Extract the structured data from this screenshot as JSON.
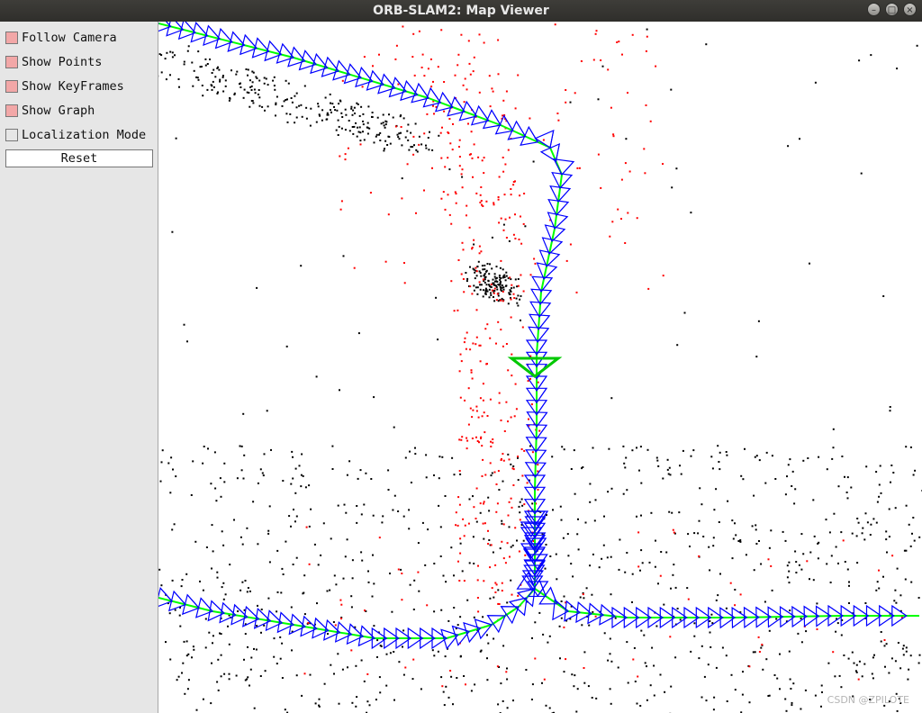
{
  "window": {
    "title": "ORB-SLAM2: Map Viewer",
    "buttons": [
      "minimize",
      "maximize",
      "close"
    ]
  },
  "panel": {
    "checkboxes": [
      {
        "label": "Follow Camera",
        "checked": true
      },
      {
        "label": "Show Points",
        "checked": true
      },
      {
        "label": "Show KeyFrames",
        "checked": true
      },
      {
        "label": "Show Graph",
        "checked": true
      },
      {
        "label": "Localization Mode",
        "checked": false
      }
    ],
    "reset_label": "Reset"
  },
  "viewer": {
    "watermark": "CSDN @ZPILOTE"
  },
  "colors": {
    "map_points": "#000000",
    "reference_points": "#ff0000",
    "keyframes": "#0000ff",
    "graph": "#00ff00",
    "current_camera": "#00c800",
    "checkbox_on": "#f2a7a7"
  }
}
